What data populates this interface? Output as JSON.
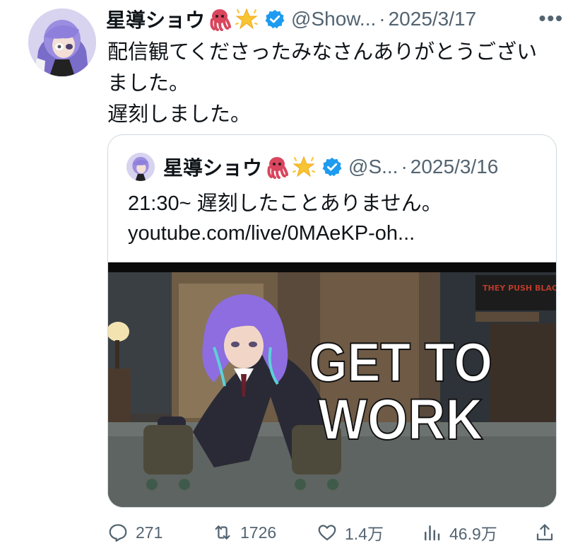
{
  "tweet": {
    "author_name": "星導ショウ",
    "emoji_1": "octopus-emoji",
    "emoji_2": "glowing-star-emoji",
    "handle": "@Show...",
    "separator": "·",
    "date": "2025/3/17",
    "more": "•••",
    "text_line_1": "配信観てくださったみなさんありがとうござい",
    "text_line_2": "ました。",
    "text_line_3": "遅刻しました。"
  },
  "quote": {
    "author_name": "星導ショウ",
    "handle": "@S...",
    "separator": "·",
    "date": "2025/3/16",
    "text_line_1": "21:30~ 遅刻したことありません。",
    "text_line_2": "youtube.com/live/0MAeKP-oh...",
    "thumbnail_text_1": "GET TO",
    "thumbnail_text_2": "WORK",
    "poster_text": "THEY PUSH BLACK"
  },
  "actions": {
    "reply_count": "271",
    "retweet_count": "1726",
    "like_count": "1.4万",
    "view_count": "46.9万"
  },
  "colors": {
    "text": "#0f1419",
    "secondary": "#536471",
    "verified": "#1d9bf0",
    "border": "#cfd9de"
  }
}
